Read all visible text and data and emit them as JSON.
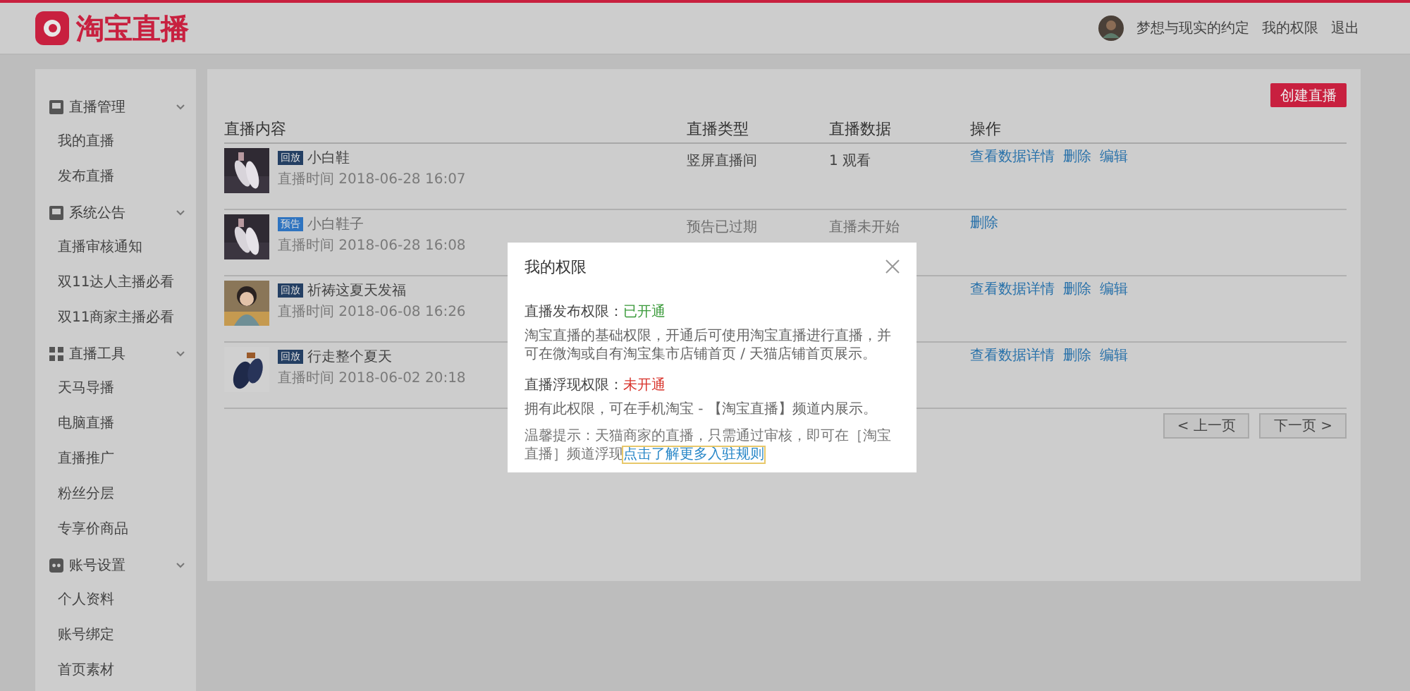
{
  "header": {
    "logo_text": "淘宝直播",
    "user_name": "梦想与现实的约定",
    "links": [
      "我的权限",
      "退出"
    ]
  },
  "sidebar": {
    "groups": [
      {
        "label": "直播管理",
        "kind": "monitor",
        "expanded": true,
        "children": [
          {
            "label": "我的直播"
          },
          {
            "label": "发布直播"
          }
        ]
      },
      {
        "label": "系统公告",
        "kind": "monitor",
        "expanded": true,
        "children": [
          {
            "label": "直播审核通知"
          },
          {
            "label": "双11达人主播必看"
          },
          {
            "label": "双11商家主播必看"
          }
        ]
      },
      {
        "label": "直播工具",
        "kind": "grid",
        "expanded": true,
        "children": [
          {
            "label": "天马导播"
          },
          {
            "label": "电脑直播"
          },
          {
            "label": "直播推广"
          },
          {
            "label": "粉丝分层"
          },
          {
            "label": "专享价商品"
          }
        ]
      },
      {
        "label": "账号设置",
        "kind": "dots",
        "expanded": true,
        "children": [
          {
            "label": "个人资料"
          },
          {
            "label": "账号绑定"
          },
          {
            "label": "首页素材"
          }
        ]
      }
    ]
  },
  "main": {
    "create_button": "创建直播",
    "table": {
      "columns": [
        "直播内容",
        "直播类型",
        "直播数据",
        "操作"
      ],
      "rows": [
        {
          "tag": "回放",
          "color": "#243f63",
          "title": "小白鞋",
          "time": "直播时间 2018-06-28 16:07",
          "type": "竖屏直播间",
          "data": "1 观看",
          "expired": false,
          "actions": [
            "查看数据详情",
            "删除",
            "编辑"
          ]
        },
        {
          "tag": "预告",
          "color": "#2f74c0",
          "title": "小白鞋子",
          "time": "直播时间 2018-06-28 16:08",
          "type": "预告已过期",
          "data": "直播未开始",
          "expired": true,
          "actions": [
            "删除"
          ]
        },
        {
          "tag": "回放",
          "color": "#243f63",
          "title": "祈祷这夏天发福",
          "time": "直播时间 2018-06-08 16:26",
          "expired": false,
          "actions": [
            "查看数据详情",
            "删除",
            "编辑"
          ]
        },
        {
          "tag": "回放",
          "color": "#243f63",
          "title": "行走整个夏天",
          "time": "直播时间 2018-06-02 20:18",
          "expired": false,
          "actions": [
            "查看数据详情",
            "删除",
            "编辑"
          ]
        }
      ]
    },
    "pagination": {
      "prev": "< 上一页",
      "next": "下一页 >"
    }
  },
  "modal": {
    "title": "我的权限",
    "sections": [
      {
        "label": "直播发布权限：",
        "status": "已开通",
        "enabled": true,
        "desc": "淘宝直播的基础权限，开通后可使用淘宝直播进行直播，并可在微淘或自有淘宝集市店铺首页 / 天猫店铺首页展示。"
      },
      {
        "label": "直播浮现权限：",
        "status": "未开通",
        "enabled": false,
        "desc": "拥有此权限，可在手机淘宝 - 【淘宝直播】频道内展示。"
      }
    ],
    "tip": "温馨提示：天猫商家的直播，只需通过审核，即可在［淘宝直播］频道浮现",
    "tip_link": "点击了解更多入驻规则"
  }
}
